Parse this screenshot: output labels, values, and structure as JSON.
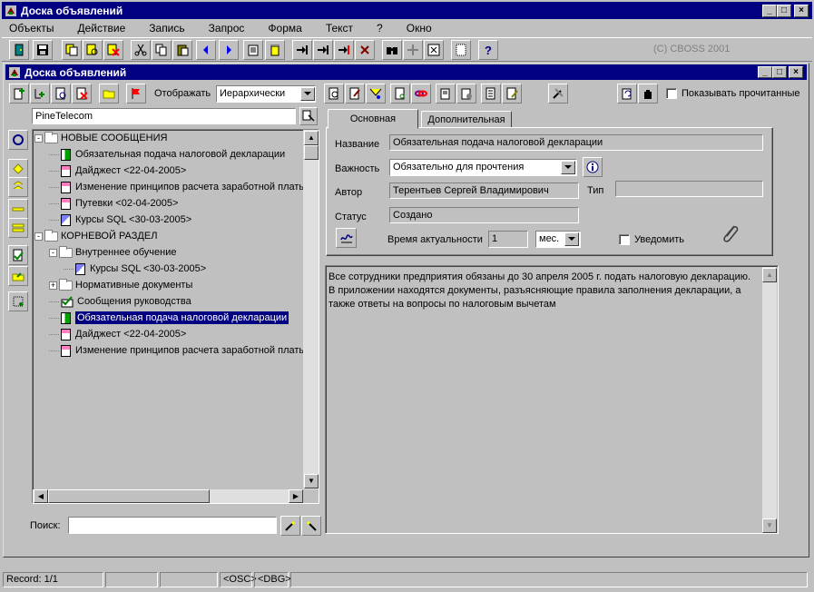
{
  "app": {
    "title": "Доска объявлений",
    "copyright": "(C) CBOSS 2001",
    "menu": [
      "Объекты",
      "Действие",
      "Запись",
      "Запрос",
      "Форма",
      "Текст",
      "?",
      "Окно"
    ]
  },
  "child": {
    "title": "Доска объявлений",
    "display_label": "Отображать",
    "display_value": "Иерархически",
    "show_read_label": "Показывать прочитанные"
  },
  "left": {
    "filter_value": "PineTelecom",
    "search_label": "Поиск:",
    "search_value": "",
    "tree": [
      {
        "level": 0,
        "type": "folder",
        "expand": "-",
        "label": "НОВЫЕ СООБЩЕНИЯ"
      },
      {
        "level": 1,
        "type": "doc-green",
        "label": "Обязательная подача налоговой декларации"
      },
      {
        "level": 1,
        "type": "doc-pink",
        "label": "Дайджест  <22-04-2005>"
      },
      {
        "level": 1,
        "type": "doc-pink",
        "label": "Изменение принципов расчета заработной платы"
      },
      {
        "level": 1,
        "type": "doc-pink",
        "label": "Путевки  <02-04-2005>"
      },
      {
        "level": 1,
        "type": "doc-course",
        "label": "Курсы SQL  <30-03-2005>"
      },
      {
        "level": 0,
        "type": "folder",
        "expand": "-",
        "label": "КОРНЕВОЙ РАЗДЕЛ"
      },
      {
        "level": 1,
        "type": "folder",
        "expand": "-",
        "label": "Внутреннее обучение"
      },
      {
        "level": 2,
        "type": "doc-course",
        "label": "Курсы SQL  <30-03-2005>"
      },
      {
        "level": 1,
        "type": "folder",
        "expand": "+",
        "label": "Нормативные документы"
      },
      {
        "level": 1,
        "type": "check",
        "label": "Сообщения руководства"
      },
      {
        "level": 1,
        "type": "doc-green",
        "label": "Обязательная подача налоговой декларации",
        "selected": true
      },
      {
        "level": 1,
        "type": "doc-pink",
        "label": "Дайджест  <22-04-2005>"
      },
      {
        "level": 1,
        "type": "doc-pink",
        "label": "Изменение принципов расчета заработной платы"
      }
    ]
  },
  "form": {
    "tabs": [
      "Основная",
      "Дополнительная"
    ],
    "active_tab": 0,
    "name_label": "Название",
    "name_value": "Обязательная подача налоговой декларации",
    "importance_label": "Важность",
    "importance_value": "Обязательно для прочтения",
    "author_label": "Автор",
    "author_value": "Терентьев  Сергей Владимирович",
    "type_label": "Тип",
    "type_value": "",
    "status_label": "Статус",
    "status_value": "Создано",
    "actuality_label": "Время актуальности",
    "actuality_value": "1",
    "actuality_unit": "мес.",
    "notify_label": "Уведомить",
    "body": "Все сотрудники предприятия обязаны до 30 апреля 2005 г. подать налоговую  декларацию. В приложении находятся документы, разъясняющие правила заполнения декларации, а также ответы на вопросы по налоговым вычетам"
  },
  "status": {
    "record": "Record: 1/1",
    "osc": "<OSC>",
    "dbg": "<DBG>"
  },
  "colors": {
    "titlebar": "#000080",
    "selection": "#000080",
    "accent": "#0000ff"
  }
}
